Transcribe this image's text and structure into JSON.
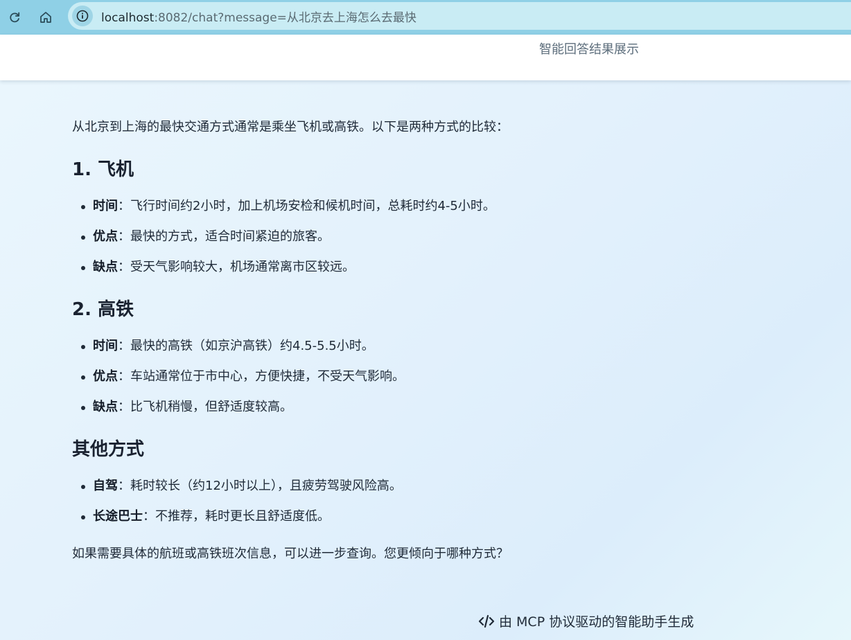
{
  "browser": {
    "url_host": "localhost",
    "url_rest": ":8082/chat?message=从北京去上海怎么去最快"
  },
  "header": {
    "title": "智能回答结果展示"
  },
  "answer": {
    "intro": "从北京到上海的最快交通方式通常是乘坐飞机或高铁。以下是两种方式的比较：",
    "sections": [
      {
        "heading": "1. 飞机",
        "items": [
          {
            "label": "时间",
            "text": "：飞行时间约2小时，加上机场安检和候机时间，总耗时约4-5小时。"
          },
          {
            "label": "优点",
            "text": "：最快的方式，适合时间紧迫的旅客。"
          },
          {
            "label": "缺点",
            "text": "：受天气影响较大，机场通常离市区较远。"
          }
        ]
      },
      {
        "heading": "2. 高铁",
        "items": [
          {
            "label": "时间",
            "text": "：最快的高铁（如京沪高铁）约4.5-5.5小时。"
          },
          {
            "label": "优点",
            "text": "：车站通常位于市中心，方便快捷，不受天气影响。"
          },
          {
            "label": "缺点",
            "text": "：比飞机稍慢，但舒适度较高。"
          }
        ]
      },
      {
        "heading": "其他方式",
        "items": [
          {
            "label": "自驾",
            "text": "：耗时较长（约12小时以上），且疲劳驾驶风险高。"
          },
          {
            "label": "长途巴士",
            "text": "：不推荐，耗时更长且舒适度低。"
          }
        ]
      }
    ],
    "closing": "如果需要具体的航班或高铁班次信息，可以进一步查询。您更倾向于哪种方式？"
  },
  "footer": {
    "text": "由 MCP 协议驱动的智能助手生成",
    "icon": "code-icon"
  }
}
